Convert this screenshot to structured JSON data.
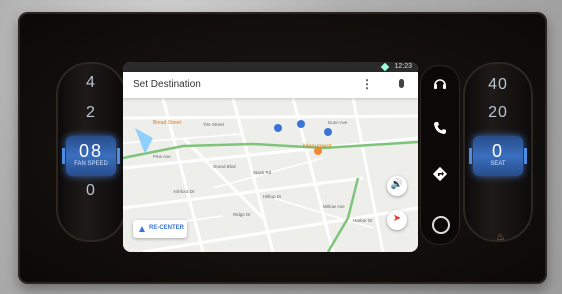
{
  "screen": {
    "status_time": "12:23",
    "search_placeholder": "Set Destination",
    "more_glyph": "⋮",
    "recenter_label": "RE-CENTER",
    "map_labels": [
      "Bread Street",
      "Tire Street",
      "Dunn Ave",
      "Pine Ave",
      "Grand Blvd",
      "Stack Rd",
      "Monument",
      "Ashford Dr",
      "Hilltop Dr",
      "Ridge Dr",
      "Oak Ave",
      "Willow Ave",
      "Harbor Dr"
    ],
    "volume_glyph": "🔊",
    "compass_glyph": "➤"
  },
  "left_dial": {
    "ticks": [
      "4",
      "2",
      "0"
    ],
    "selected_value": "08",
    "selected_sub": "FAN SPEED"
  },
  "right_dial": {
    "ticks": [
      "40",
      "20",
      "0"
    ],
    "selected_value": "0",
    "selected_sub": "SEAT"
  },
  "rail": {
    "icons": [
      "headphones-icon",
      "phone-icon",
      "directions-icon",
      "home-icon"
    ]
  },
  "colors": {
    "accent_blue": "#3b74d8",
    "route": "#7fc47a",
    "poi_orange": "#f0883a",
    "poi_blue": "#3b74d8"
  }
}
